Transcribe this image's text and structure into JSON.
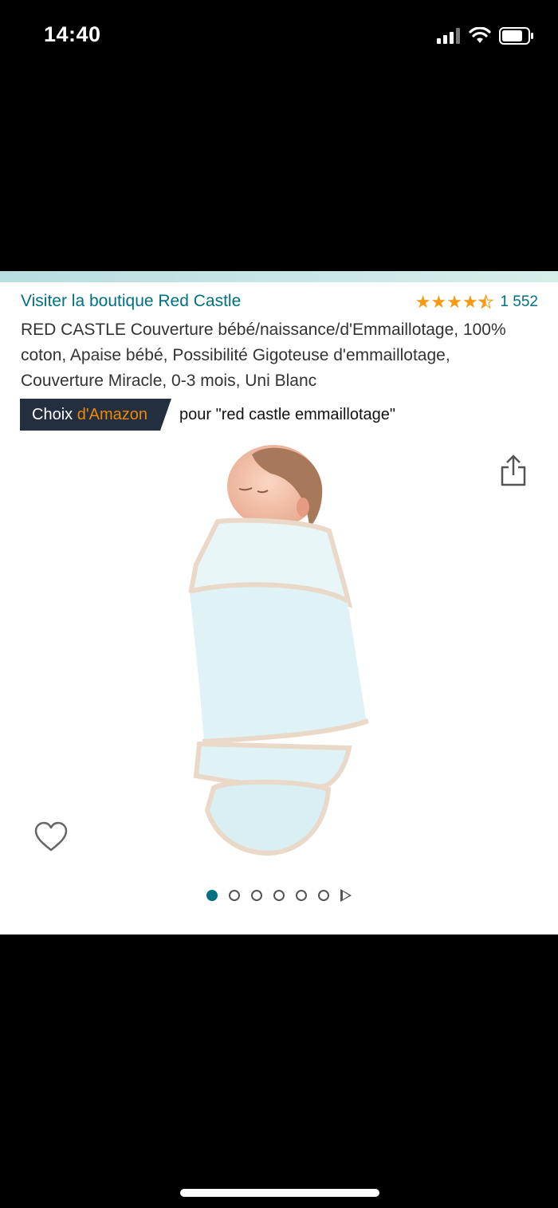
{
  "status_bar": {
    "time": "14:40",
    "icons": [
      "signal-icon",
      "wifi-icon",
      "battery-icon"
    ]
  },
  "product": {
    "store_link": "Visiter la boutique Red Castle",
    "rating": {
      "stars": 4.5,
      "count": "1 552"
    },
    "title": "RED CASTLE Couverture bébé/naissance/d'Emmaillotage, 100% coton, Apaise bébé, Possibilité Gigoteuse d'emmaillotage, Couverture Miracle, 0-3 mois, Uni Blanc",
    "badge": {
      "prefix": "Choix ",
      "brand": "d'Amazon"
    },
    "badge_query": "pour \"red castle emmaillotage\"",
    "gallery": {
      "current": 1,
      "total_dots": 6
    }
  },
  "colors": {
    "link": "#007185",
    "star": "#f79a12",
    "badge_bg": "#232f3e",
    "badge_accent": "#f08804"
  }
}
